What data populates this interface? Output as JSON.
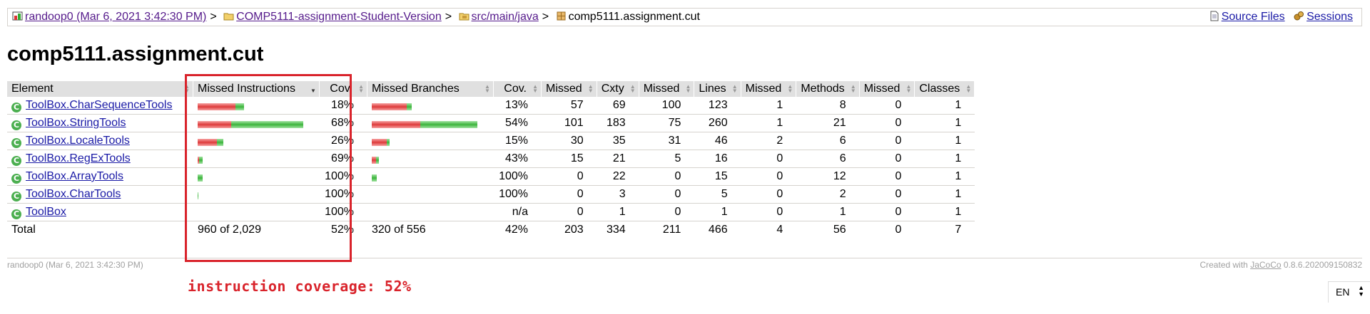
{
  "breadcrumb": {
    "session": "randoop0 (Mar 6, 2021 3:42:30 PM)",
    "project": "COMP5111-assignment-Student-Version",
    "source_folder": "src/main/java",
    "package": "comp5111.assignment.cut",
    "separator": ">",
    "source_files": "Source Files",
    "sessions": "Sessions",
    "icons": [
      "session-icon",
      "folder-icon",
      "source-folder-icon",
      "package-icon",
      "source-files-icon",
      "sessions-icon"
    ]
  },
  "page_title": "comp5111.assignment.cut",
  "table": {
    "headers": [
      "Element",
      "Missed Instructions",
      "Cov.",
      "Missed Branches",
      "Cov.",
      "Missed",
      "Cxty",
      "Missed",
      "Lines",
      "Missed",
      "Methods",
      "Missed",
      "Classes"
    ],
    "rows": [
      {
        "name": "ToolBox.CharSequenceTools",
        "instr_missed_frac": 0.82,
        "instr_cov": "18%",
        "br_missed_frac": 0.87,
        "br_cov": "13%",
        "cx_missed": "57",
        "cxty": "69",
        "lines_missed": "100",
        "lines": "123",
        "meth_missed": "1",
        "methods": "8",
        "cls_missed": "0",
        "classes": "1"
      },
      {
        "name": "ToolBox.StringTools",
        "instr_missed_frac": 0.32,
        "instr_cov": "68%",
        "br_missed_frac": 0.46,
        "br_cov": "54%",
        "cx_missed": "101",
        "cxty": "183",
        "lines_missed": "75",
        "lines": "260",
        "meth_missed": "1",
        "methods": "21",
        "cls_missed": "0",
        "classes": "1"
      },
      {
        "name": "ToolBox.LocaleTools",
        "instr_missed_frac": 0.74,
        "instr_cov": "26%",
        "br_missed_frac": 0.85,
        "br_cov": "15%",
        "cx_missed": "30",
        "cxty": "35",
        "lines_missed": "31",
        "lines": "46",
        "meth_missed": "2",
        "methods": "6",
        "cls_missed": "0",
        "classes": "1"
      },
      {
        "name": "ToolBox.RegExTools",
        "instr_missed_frac": 0.31,
        "instr_cov": "69%",
        "br_missed_frac": 0.57,
        "br_cov": "43%",
        "cx_missed": "15",
        "cxty": "21",
        "lines_missed": "5",
        "lines": "16",
        "meth_missed": "0",
        "methods": "6",
        "cls_missed": "0",
        "classes": "1"
      },
      {
        "name": "ToolBox.ArrayTools",
        "instr_missed_frac": 0,
        "instr_cov": "100%",
        "br_missed_frac": 0,
        "br_cov": "100%",
        "cx_missed": "0",
        "cxty": "22",
        "lines_missed": "0",
        "lines": "15",
        "meth_missed": "0",
        "methods": "12",
        "cls_missed": "0",
        "classes": "1"
      },
      {
        "name": "ToolBox.CharTools",
        "instr_missed_frac": 0,
        "instr_cov": "100%",
        "br_missed_frac": 0,
        "br_cov": "100%",
        "cx_missed": "0",
        "cxty": "3",
        "lines_missed": "0",
        "lines": "5",
        "meth_missed": "0",
        "methods": "2",
        "cls_missed": "0",
        "classes": "1"
      },
      {
        "name": "ToolBox",
        "instr_missed_frac": 0,
        "instr_cov": "100%",
        "br_missed_frac": 0,
        "br_cov": "n/a",
        "cx_missed": "0",
        "cxty": "1",
        "lines_missed": "0",
        "lines": "1",
        "meth_missed": "0",
        "methods": "1",
        "cls_missed": "0",
        "classes": "1"
      }
    ],
    "bar_totals": {
      "instr": [
        0.44,
        1.0,
        0.24,
        0.05,
        0.05,
        0.01,
        0
      ],
      "branch": [
        0.38,
        1.0,
        0.17,
        0.07,
        0.05,
        0,
        0
      ]
    },
    "total": {
      "label": "Total",
      "instr": "960 of 2,029",
      "instr_cov": "52%",
      "br": "320 of 556",
      "br_cov": "42%",
      "cx_missed": "203",
      "cxty": "334",
      "lines_missed": "211",
      "lines": "466",
      "meth_missed": "4",
      "methods": "56",
      "cls_missed": "0",
      "classes": "7"
    }
  },
  "footer": {
    "left": "randoop0 (Mar 6, 2021 3:42:30 PM)",
    "right_prefix": "Created with",
    "right_link": "JaCoCo",
    "right_suffix": "0.8.6.202009150832"
  },
  "annotation": "instruction coverage: 52%",
  "language": "EN",
  "colors": {
    "highlight": "#d9232b",
    "bar_red": "#dd3b3b",
    "bar_green": "#3cb43c",
    "header_bg": "#e0e0e0"
  }
}
